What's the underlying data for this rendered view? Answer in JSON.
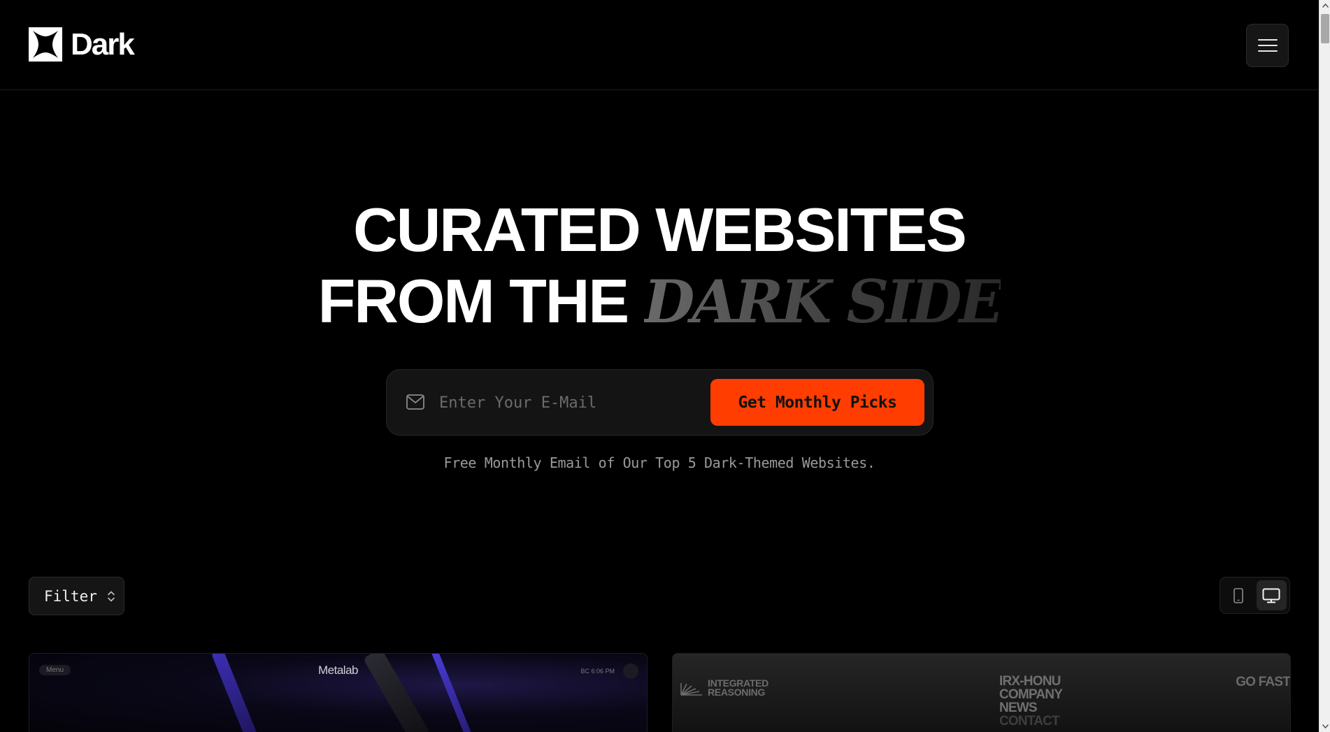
{
  "header": {
    "brand": "Dark",
    "menu_icon": "hamburger-menu-icon"
  },
  "hero": {
    "title_line_1": "CURATED WEBSITES",
    "title_line_2_plain": "FROM THE ",
    "title_line_2_accent": "DARK SIDE",
    "email_placeholder": "Enter Your E-Mail",
    "email_value": "",
    "email_icon": "mail-icon",
    "cta_label": "Get Monthly Picks",
    "note": "Free Monthly Email of Our Top 5 Dark-Themed Websites.",
    "colors": {
      "cta": "#ff3d00",
      "background": "#000000"
    }
  },
  "toolbar": {
    "filter_label": "Filter",
    "filter_icon": "chevron-up-down-icon",
    "view_options": [
      {
        "icon": "mobile-icon",
        "active": false
      },
      {
        "icon": "desktop-icon",
        "active": true
      }
    ]
  },
  "cards": [
    {
      "menu_label": "Menu",
      "site_name": "Metalab",
      "time": "BC 6:06 PM"
    },
    {
      "logo_text": "INTEGRATED\nREASONING",
      "nav": [
        "IRX-HONU",
        "COMPANY",
        "NEWS",
        "CONTACT"
      ],
      "cta": "GO FAST"
    }
  ]
}
